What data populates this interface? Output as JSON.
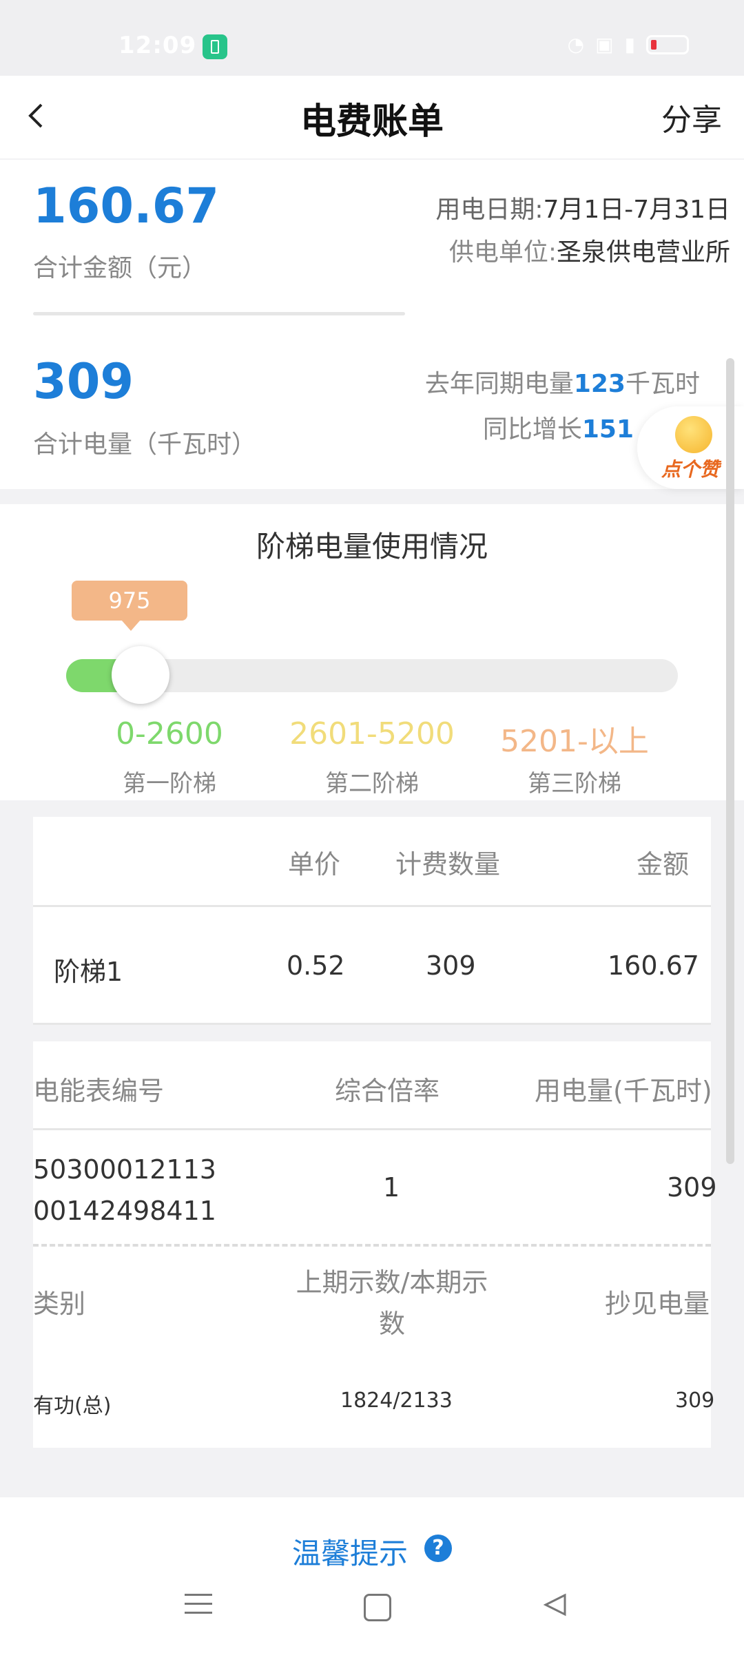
{
  "status_bar": {
    "time": "12:09"
  },
  "header": {
    "title": "电费账单",
    "share_label": "分享"
  },
  "summary": {
    "total_amount": "160.67",
    "total_amount_label": "合计金额（元）",
    "date_label": "用电日期:",
    "date_value": "7月1日-7月31日",
    "org_label": "供电单位:",
    "org_value": "圣泉供电营业所",
    "total_kwh": "309",
    "total_kwh_label": "合计电量（千瓦时）",
    "last_year_prefix": "去年同期电量",
    "last_year_value": "123",
    "last_year_unit": "千瓦时",
    "yoy_prefix": "同比增长",
    "yoy_value": "151"
  },
  "like_button": {
    "label": "点个赞"
  },
  "ladder": {
    "title": "阶梯电量使用情况",
    "marker_value": "975",
    "progress_fraction": 0.118,
    "tiers": [
      {
        "range": "0-2600",
        "name": "第一阶梯",
        "color": "#7ed86c"
      },
      {
        "range": "2601-5200",
        "name": "第二阶梯",
        "color": "#f1dc7a"
      },
      {
        "range": "5201-以上",
        "name": "第三阶梯",
        "color": "#f3b788"
      }
    ]
  },
  "bill_table": {
    "headers": [
      "",
      "单价",
      "计费数量",
      "金额"
    ],
    "rows": [
      [
        "阶梯1",
        "0.52",
        "309",
        "160.67"
      ]
    ]
  },
  "meter": {
    "headers": [
      "电能表编号",
      "综合倍率",
      "用电量(千瓦时)"
    ],
    "number_line1": "50300012113",
    "number_line2": "00142498411",
    "multiplier": "1",
    "usage": "309",
    "reading_headers": [
      "类别",
      "上期示数/本期示数",
      "抄见电量"
    ],
    "reading_row": [
      "有功(总)",
      "1824/2133",
      "309"
    ]
  },
  "footer": {
    "warm_tip": "温馨提示",
    "help_icon_glyph": "?"
  }
}
